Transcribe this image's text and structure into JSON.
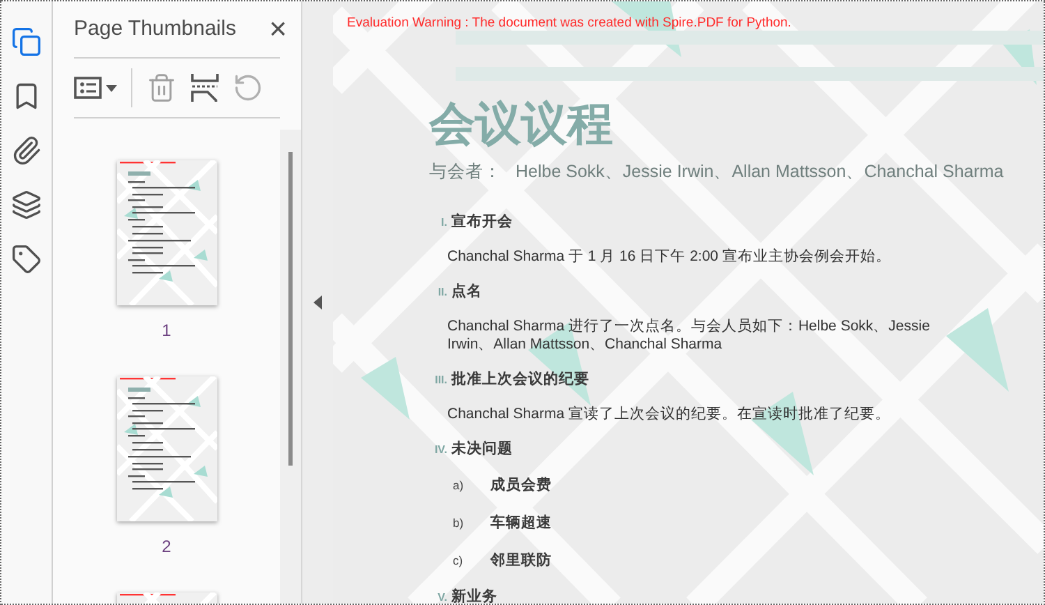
{
  "rail": [
    {
      "kind": "pages",
      "selected": true
    },
    {
      "kind": "bookmark",
      "selected": false
    },
    {
      "kind": "attachment",
      "selected": false
    },
    {
      "kind": "layers",
      "selected": false
    },
    {
      "kind": "tag",
      "selected": false
    }
  ],
  "panel": {
    "title": "Page Thumbnails",
    "close": "×"
  },
  "thumbnails": [
    {
      "label": "1",
      "cut_off": false
    },
    {
      "label": "2",
      "cut_off": false
    },
    {
      "cut_off": true
    }
  ],
  "document": {
    "warning": "Evaluation Warning : The document was created with Spire.PDF for Python.",
    "title": "会议议程",
    "attendees_label": "与会者：",
    "attendees": "Helbe Sokk、Jessie Irwin、Allan Mattsson、Chanchal Sharma",
    "sections": [
      {
        "numeral": "I.",
        "heading": "宣布开会",
        "body": "Chanchal Sharma 于 1 月 16 日下午 2:00 宣布业主协会例会开始。"
      },
      {
        "numeral": "II.",
        "heading": "点名",
        "body": "Chanchal Sharma 进行了一次点名。与会人员如下：Helbe Sokk、Jessie Irwin、Allan Mattsson、Chanchal Sharma"
      },
      {
        "numeral": "III.",
        "heading": "批准上次会议的纪要",
        "body": "Chanchal Sharma 宣读了上次会议的纪要。在宣读时批准了纪要。"
      },
      {
        "numeral": "IV.",
        "heading": "未决问题",
        "items": [
          {
            "marker": "a)",
            "text": "成员会费"
          },
          {
            "marker": "b)",
            "text": "车辆超速"
          },
          {
            "marker": "c)",
            "text": "邻里联防"
          }
        ]
      },
      {
        "numeral": "V.",
        "heading": "新业务"
      }
    ]
  }
}
